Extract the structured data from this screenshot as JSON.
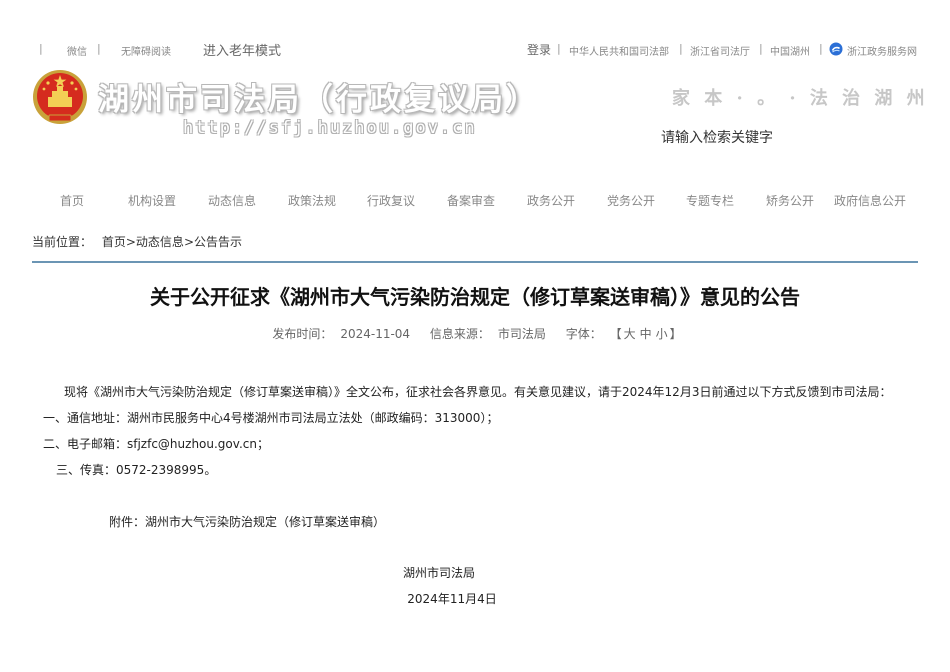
{
  "topbar": {
    "wechat": "微信",
    "accessible": "无障碍阅读",
    "elder_mode": "进入老年模式",
    "login": "登录",
    "links": [
      "中华人民共和国司法部",
      "浙江省司法厅",
      "中国湖州",
      "浙江政务服务网"
    ]
  },
  "header": {
    "title": "湖州市司法局（行政复议局）",
    "url": "http://sfj.huzhou.gov.cn",
    "slogan": "家 本 · 。 · 法 治 湖 州",
    "search_placeholder": "请输入检索关键字"
  },
  "nav": [
    "首页",
    "机构设置",
    "动态信息",
    "政策法规",
    "行政复议",
    "备案审查",
    "政务公开",
    "党务公开",
    "专题专栏",
    "矫务公开",
    "政府信息公开"
  ],
  "breadcrumb": {
    "label": "当前位置：",
    "home": "首页",
    "sep1": ">",
    "section": "动态信息",
    "sep2": ">",
    "current": "公告告示"
  },
  "article": {
    "title": "关于公开征求《湖州市大气污染防治规定（修订草案送审稿）》意见的公告",
    "publish_label": "发布时间：",
    "publish_date": "2024-11-04",
    "source_label": "信息来源：",
    "source": "市司法局",
    "font_label": "字体：",
    "font_open": "【",
    "font_large": "大",
    "font_medium": "中",
    "font_small": "小",
    "font_close": "】",
    "intro": "现将《湖州市大气污染防治规定（修订草案送审稿）》全文公布，征求社会各界意见。有关意见建议，请于2024年12月3日前通过以下方式反馈到市司法局：",
    "item1": "一、通信地址：湖州市民服务中心4号楼湖州市司法局立法处（邮政编码：313000）；",
    "item2": "二、电子邮箱：sfjzfc@huzhou.gov.cn；",
    "item3": "三、传真：0572-2398995。",
    "attachment_label": "附件：",
    "attachment": "湖州市大气污染防治规定（修订草案送审稿）",
    "signature": "湖州市司法局",
    "date": "2024年11月4日"
  }
}
